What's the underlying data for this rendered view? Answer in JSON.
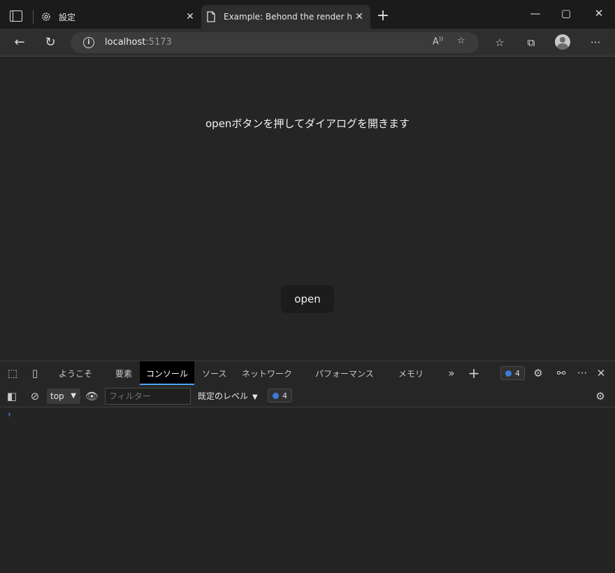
{
  "browser": {
    "tabs": [
      {
        "label": "設定",
        "icon": "gear-icon"
      },
      {
        "label": "Example: Behond the render hoo",
        "icon": "page-icon"
      }
    ],
    "url_host": "localhost",
    "url_port": ":5173"
  },
  "page": {
    "instruction": "openボタンを押してダイアログを開きます",
    "open_button_label": "open"
  },
  "devtools": {
    "tabs": [
      "ようこそ",
      "要素",
      "コンソール",
      "ソース",
      "ネットワーク",
      "パフォーマンス",
      "メモリ"
    ],
    "active_tab": "コンソール",
    "issues_count": "4",
    "context": "top",
    "filter_placeholder": "フィルター",
    "levels_label": "既定のレベル",
    "console_issues_count": "4",
    "prompt": "›"
  }
}
